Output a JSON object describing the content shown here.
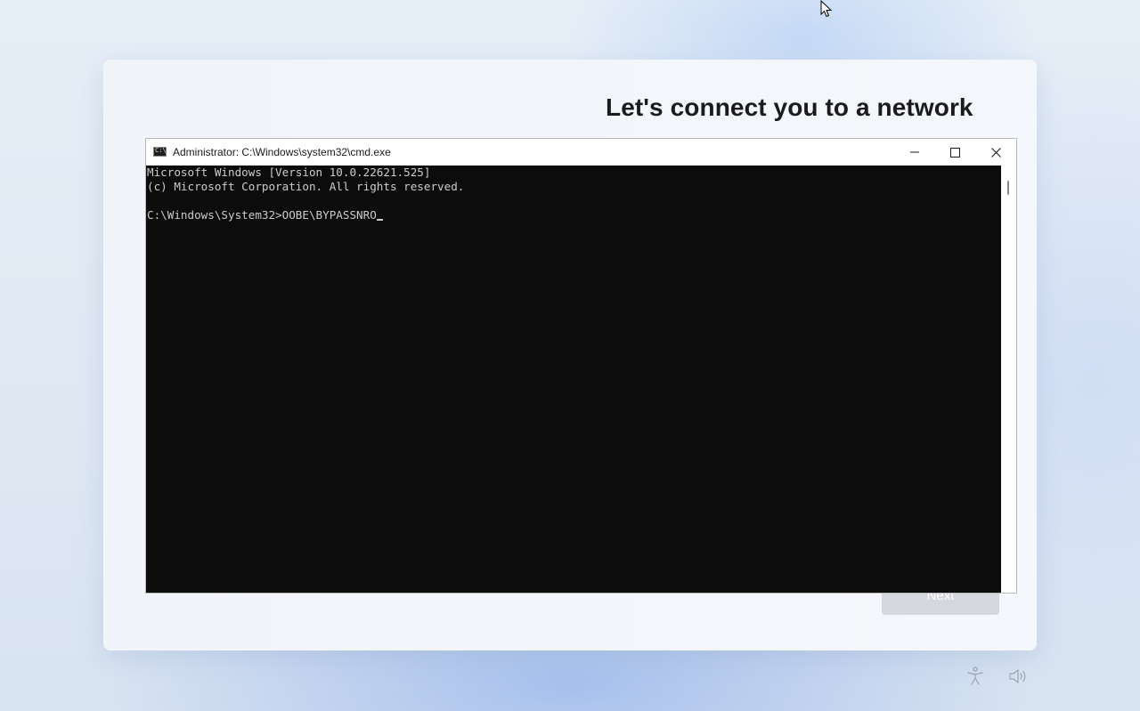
{
  "oobe": {
    "title": "Let's connect you to a network",
    "next_label": "Next"
  },
  "cmd": {
    "title": "Administrator: C:\\Windows\\system32\\cmd.exe",
    "lines": [
      "Microsoft Windows [Version 10.0.22621.525]",
      "(c) Microsoft Corporation. All rights reserved.",
      "C:\\Windows\\System32>OOBE\\BYPASSNRO"
    ],
    "colors": {
      "background": "#0c0c0c",
      "text": "#cccccc"
    }
  },
  "icons": {
    "app": "cmd-icon",
    "minimize": "minimize-icon",
    "maximize": "maximize-icon",
    "close": "close-icon",
    "accessibility": "accessibility-icon",
    "volume": "volume-icon",
    "pointer": "mouse-pointer-icon"
  }
}
